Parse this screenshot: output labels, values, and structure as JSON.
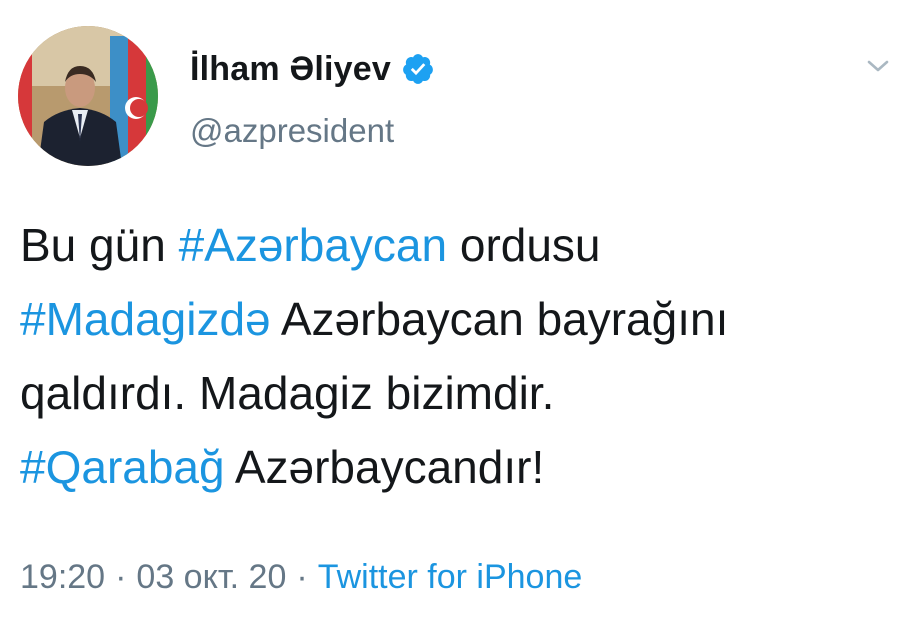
{
  "author": {
    "display_name": "İlham Əliyev",
    "handle": "@azpresident",
    "verified": true,
    "avatar_icon": "profile-photo-icon"
  },
  "menu": {
    "icon": "chevron-down-icon"
  },
  "tweet": {
    "lines": [
      [
        {
          "text": "Bu gün ",
          "hashtag": false
        },
        {
          "text": "#Azərbaycan",
          "hashtag": true
        },
        {
          "text": " ordusu",
          "hashtag": false
        }
      ],
      [
        {
          "text": "#Madagizdə",
          "hashtag": true
        },
        {
          "text": " Azərbaycan bayrağını",
          "hashtag": false
        }
      ],
      [
        {
          "text": "qaldırdı. Madagiz bizimdir.",
          "hashtag": false
        }
      ],
      [
        {
          "text": "#Qarabağ",
          "hashtag": true
        },
        {
          "text": " Azərbaycandır!",
          "hashtag": false
        }
      ]
    ]
  },
  "meta": {
    "time": "19:20",
    "separator": "·",
    "date": "03 окт. 20",
    "source": "Twitter for iPhone"
  },
  "colors": {
    "link": "#1b95e0",
    "secondary_text": "#657786",
    "primary_text": "#14171a",
    "verified_badge": "#1da1f2"
  }
}
